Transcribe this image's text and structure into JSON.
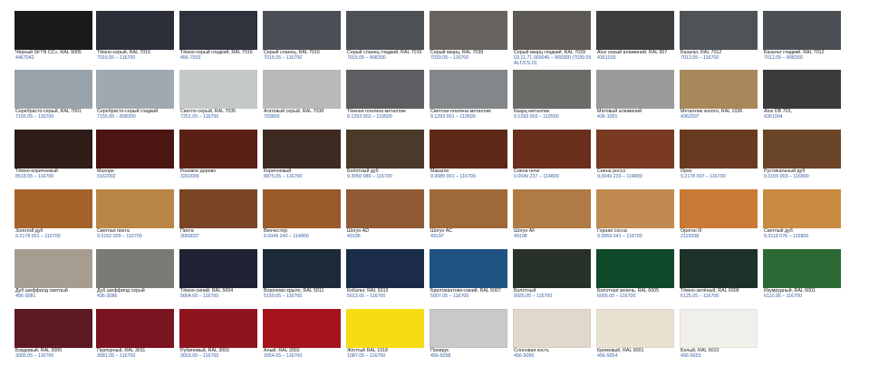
{
  "rows": [
    [
      {
        "name": "Чёрный SFTN CC», RAL 9005",
        "code": "4467042",
        "color": "#1b1a1a"
      },
      {
        "name": "Тёмно-серый, RAL 7016",
        "code": "7016.05 – 116700",
        "color": "#2c2f39"
      },
      {
        "name": "Тёмно-серый гладкий, RAL 7016",
        "code": "456-7003",
        "color": "#2f333d"
      },
      {
        "name": "Серый сланец, RAL 7015",
        "code": "7015.05 – 116700",
        "color": "#4c4f55"
      },
      {
        "name": "Серый сланец гладкий, RAL 7015",
        "code": "7015.05 – 808300",
        "color": "#4d5055"
      },
      {
        "name": "Серый кварц, RAL 7039",
        "code": "7039.05 – 116700",
        "color": "#67625d"
      },
      {
        "name": "Серый кварц гладкий, RAL 7039",
        "code": "03.11.71.000046 – 808300 (7039.05 ALT/CS.O)",
        "color": "#5b5855"
      },
      {
        "name": "Alux серый алюминий, RAL 907",
        "code": "4361016",
        "color": "#3d3e40"
      },
      {
        "name": "Базальт, RAL 7012",
        "code": "7012.05 – 116700",
        "color": "#4e5356"
      },
      {
        "name": "Базальт гладкий, RAL 7012",
        "code": "7012.05 – 808300",
        "color": "#4b5054"
      }
    ],
    [
      {
        "name": "Серебристо-серый, RAL 7001",
        "code": "7155.05 – 116700",
        "color": "#9aa3aa"
      },
      {
        "name": "Серебристо-серый гладкий",
        "code": "7155.05 – 808300",
        "color": "#a0a9b0"
      },
      {
        "name": "Светло-серый, RAL 7035",
        "code": "7251.05 – 116700",
        "color": "#c4c8c8"
      },
      {
        "name": "Агатовый серый, RAL 7038",
        "code": "703805",
        "color": "#b7bab6"
      },
      {
        "name": "Тёмная платина металлик",
        "code": "9.1293 002 – 119500",
        "color": "#5c5e61"
      },
      {
        "name": "Светлая платина металлик",
        "code": "9.1293 001 – 119500",
        "color": "#83878a"
      },
      {
        "name": "Кварц металлик",
        "code": "9.1293 003 – 119500",
        "color": "#6d6b68"
      },
      {
        "name": "Матовый алюминий",
        "code": "436-1001",
        "color": "#9a9b9b"
      },
      {
        "name": "Металлик золото, RAL 1036",
        "code": "4362007",
        "color": "#a8875a"
      },
      {
        "name": "Alux DB 703,",
        "code": "4361004",
        "color": "#3b3b3c"
      }
    ],
    [
      {
        "name": "Тёмно-коричневый",
        "code": "8518.05 – 116700",
        "color": "#2e1d18"
      },
      {
        "name": "Махоре",
        "code": "3162002",
        "color": "#4a1512"
      },
      {
        "name": "Розовое дерево",
        "code": "3202009",
        "color": "#5a2016"
      },
      {
        "name": "Коричневый",
        "code": "8875.05 – 116700",
        "color": "#3f2a22"
      },
      {
        "name": "Болотный дуб",
        "code": "9.3050 089 – 116700",
        "color": "#4a3a2a"
      },
      {
        "name": "Макагон",
        "code": "9.3085 001 – 116700",
        "color": "#5e2a18"
      },
      {
        "name": "Сиена ноче",
        "code": "9.0049 237 – 114800",
        "color": "#6a2f1c"
      },
      {
        "name": "Сиена россо",
        "code": "9.0049 233 – 114800",
        "color": "#7a3a22"
      },
      {
        "name": "Орех",
        "code": "9.2178 007 – 116700",
        "color": "#6a3a20"
      },
      {
        "name": "Рустикальный дуб",
        "code": "9.3156 003 – 116800",
        "color": "#6b4528"
      }
    ],
    [
      {
        "name": "Золотой дуб",
        "code": "9.2178 001 – 116700",
        "color": "#a4622a"
      },
      {
        "name": "Светлая пихта",
        "code": "9.3152 009 – 116700",
        "color": "#b98645"
      },
      {
        "name": "Пихта",
        "code": "3069037",
        "color": "#7a4525"
      },
      {
        "name": "Винчестер",
        "code": "9.0049 240 – 114800",
        "color": "#9a5a2a"
      },
      {
        "name": "Шогун AD",
        "code": "49195",
        "color": "#8f5a35"
      },
      {
        "name": "Шогун AC",
        "code": "49197",
        "color": "#9f6838"
      },
      {
        "name": "Шогун AF",
        "code": "49198",
        "color": "#b07a45"
      },
      {
        "name": "Горная сосна",
        "code": "9.3069 041 – 116700",
        "color": "#c08a50"
      },
      {
        "name": "Орегон III",
        "code": "2115008",
        "color": "#c87a35"
      },
      {
        "name": "Светлый дуб",
        "code": "9.3118 076 – 116800",
        "color": "#c98a42"
      }
    ],
    [
      {
        "name": "Дуб шеффилд светлый",
        "code": "456-3081",
        "color": "#a69c8f"
      },
      {
        "name": "Дуб шеффилд серый",
        "code": "436-3086",
        "color": "#7a7b76"
      },
      {
        "name": "Тёмно-синий, RAL 5004",
        "code": "5004.05 – 116700",
        "color": "#1f2333"
      },
      {
        "name": "Вороново крыло, RAL 5011",
        "code": "5150.05 – 116700",
        "color": "#1d2a3a"
      },
      {
        "name": "Кобальт, RAL 5013",
        "code": "5013.05 – 116700",
        "color": "#1b2b4a"
      },
      {
        "name": "Бриллиантово-синий, RAL 5007",
        "code": "5007.05 – 116700",
        "color": "#1f5382"
      },
      {
        "name": "Болотный",
        "code": "9925.05 – 116700",
        "color": "#28322b"
      },
      {
        "name": "Болотная зелень, RAL 6005",
        "code": "6005.05 – 116700",
        "color": "#0f4a2a"
      },
      {
        "name": "Тёмно-зелёный, RAL 6009",
        "code": "6125.05 – 116700",
        "color": "#1d3128"
      },
      {
        "name": "Изумрудный, RAL 6001",
        "code": "6110.05 – 116700",
        "color": "#2c6a35"
      }
    ],
    [
      {
        "name": "Бордовый, RAL 3005",
        "code": "3005.05 – 116700",
        "color": "#5e1a22"
      },
      {
        "name": "Пурпурный, RAL 3011",
        "code": "3081.05 – 116700",
        "color": "#7a1420"
      },
      {
        "name": "Рубиновый, RAL 3003",
        "code": "3003.05 – 116700",
        "color": "#8e1520"
      },
      {
        "name": "Алый, RAL 3002",
        "code": "3054.05 – 116700",
        "color": "#a5141c"
      },
      {
        "name": "Жёлтый RAL 1018",
        "code": "1087.05 – 116700",
        "color": "#f5dc14"
      },
      {
        "name": "Папирус",
        "code": "456-5058",
        "color": "#c9cac8"
      },
      {
        "name": "Слоновая кость",
        "code": "456-5056",
        "color": "#ded9ca"
      },
      {
        "name": "Кремовый, RAL 9001",
        "code": "456-5054",
        "color": "#e9e2d2"
      },
      {
        "name": "Белый, RAL 9010",
        "code": "456-5053",
        "color": "#f1efea"
      }
    ]
  ]
}
